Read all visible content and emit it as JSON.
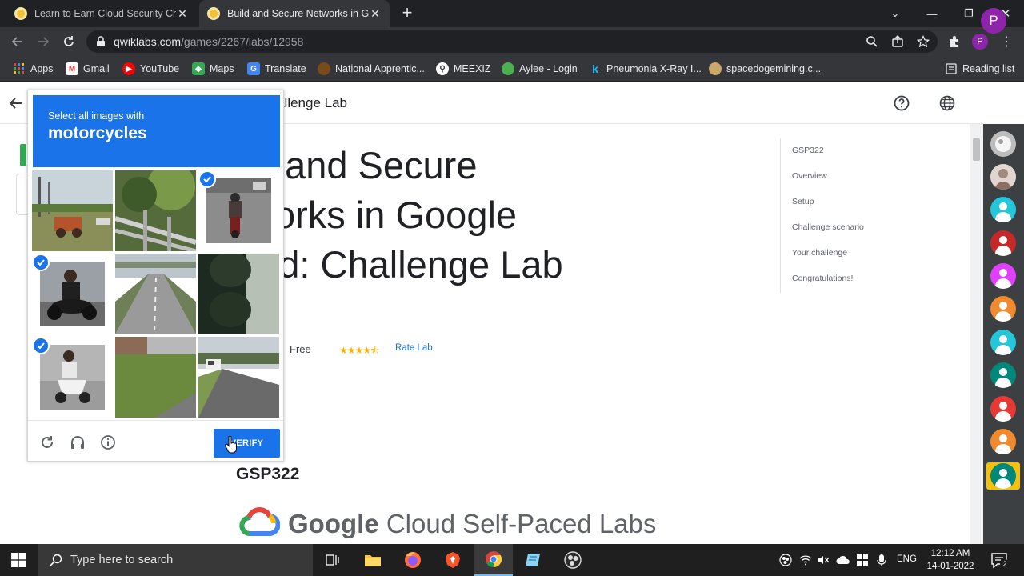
{
  "browser": {
    "tabs": [
      {
        "title": "Learn to Earn Cloud Security Cha",
        "active": false
      },
      {
        "title": "Build and Secure Networks in Go",
        "active": true
      }
    ],
    "url_host": "qwiklabs.com",
    "url_path": "/games/2267/labs/12958",
    "profile_initial": "P",
    "bookmarks": [
      "Apps",
      "Gmail",
      "YouTube",
      "Maps",
      "Translate",
      "National Apprentic...",
      "MEEXIZ",
      "Aylee - Login",
      "Pneumonia X-Ray I...",
      "spacedogemining.c..."
    ],
    "reading_list": "Reading list"
  },
  "page": {
    "header_title": "ud: Challenge Lab",
    "avatar_initial": "P",
    "title_lines": [
      "ild and Secure",
      "tworks in Google",
      "oud: Challenge Lab"
    ],
    "price": "Free",
    "stars": "★★★★⯪",
    "rate_lab": "Rate Lab",
    "lab_code": "GSP322",
    "logo_text_google": "Google",
    "logo_text_rest": "Cloud Self-Paced Labs",
    "toc": [
      "GSP322",
      "Overview",
      "Setup",
      "Challenge scenario",
      "Your challenge",
      "Congratulations!"
    ]
  },
  "captcha": {
    "prompt": "Select all images with",
    "target": "motorcycles",
    "verify_label": "VERIFY",
    "tiles": [
      {
        "subject": "field-tractor",
        "selected": false
      },
      {
        "subject": "fence-foliage",
        "selected": false
      },
      {
        "subject": "motorcycle-road",
        "selected": true
      },
      {
        "subject": "motorcycle-rider",
        "selected": true
      },
      {
        "subject": "highway",
        "selected": false
      },
      {
        "subject": "dark-closeup",
        "selected": false
      },
      {
        "subject": "scooter-rider",
        "selected": true
      },
      {
        "subject": "grass-road",
        "selected": false
      },
      {
        "subject": "van-road",
        "selected": false
      }
    ]
  },
  "taskbar": {
    "search_placeholder": "Type here to search",
    "language": "ENG",
    "time": "12:12 AM",
    "date": "14-01-2022",
    "notification_count": "2"
  },
  "colors": {
    "captcha_blue": "#1a73e8",
    "chrome_dark": "#202124",
    "profile_purple": "#8e24aa"
  }
}
